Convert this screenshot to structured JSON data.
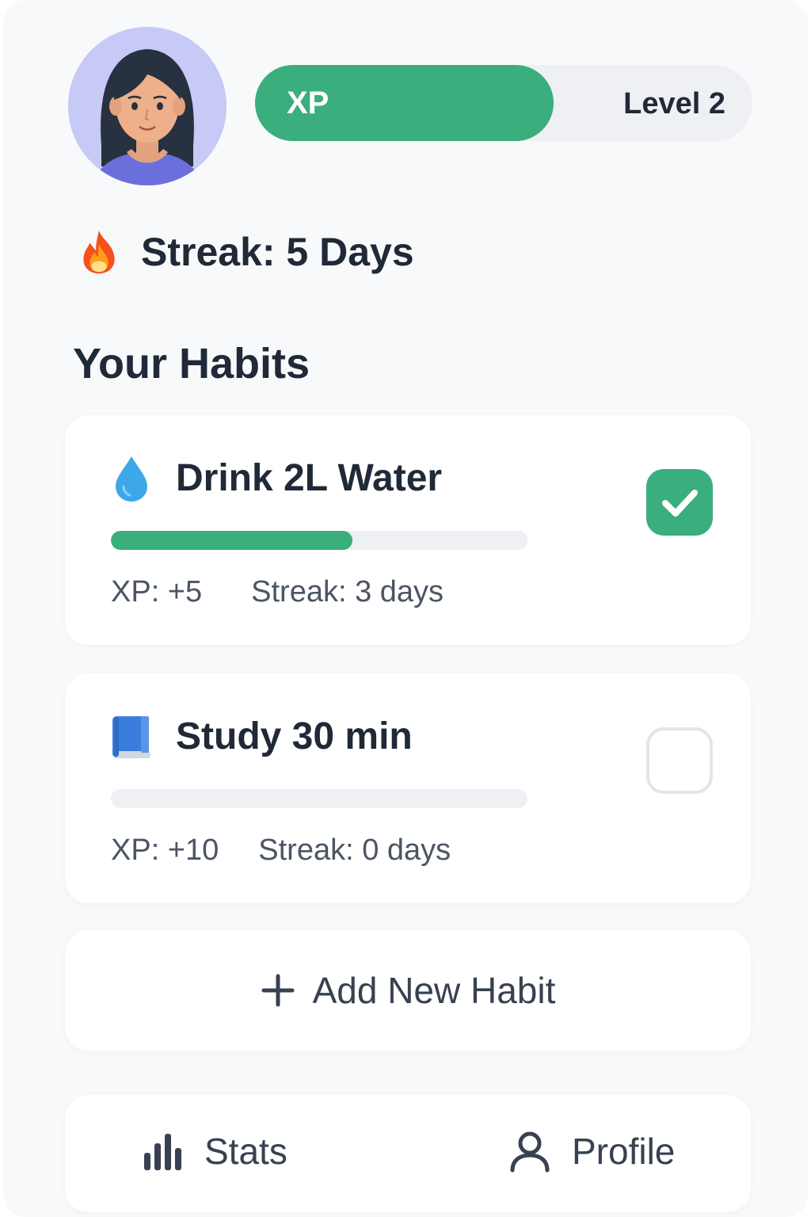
{
  "header": {
    "xp_label": "XP",
    "xp_progress": 0.6,
    "level_label": "Level 2",
    "avatar_icon": "user-avatar",
    "accent_color": "#3aae7c"
  },
  "streak": {
    "icon": "fire-icon",
    "text": "Streak: 5 Days"
  },
  "section_title": "Your Habits",
  "habits": [
    {
      "icon": "water-drop-icon",
      "title": "Drink 2L Water",
      "progress": 0.58,
      "xp": "XP: +5",
      "streak": "Streak: 3 days",
      "completed": true
    },
    {
      "icon": "book-icon",
      "title": "Study 30 min",
      "progress": 0,
      "xp": "XP: +10",
      "streak": "Streak: 0 days",
      "completed": false
    }
  ],
  "add_habit": {
    "icon": "plus-icon",
    "label": "Add New Habit"
  },
  "nav": {
    "stats": {
      "icon": "bar-chart-icon",
      "label": "Stats"
    },
    "profile": {
      "icon": "person-icon",
      "label": "Profile"
    }
  }
}
